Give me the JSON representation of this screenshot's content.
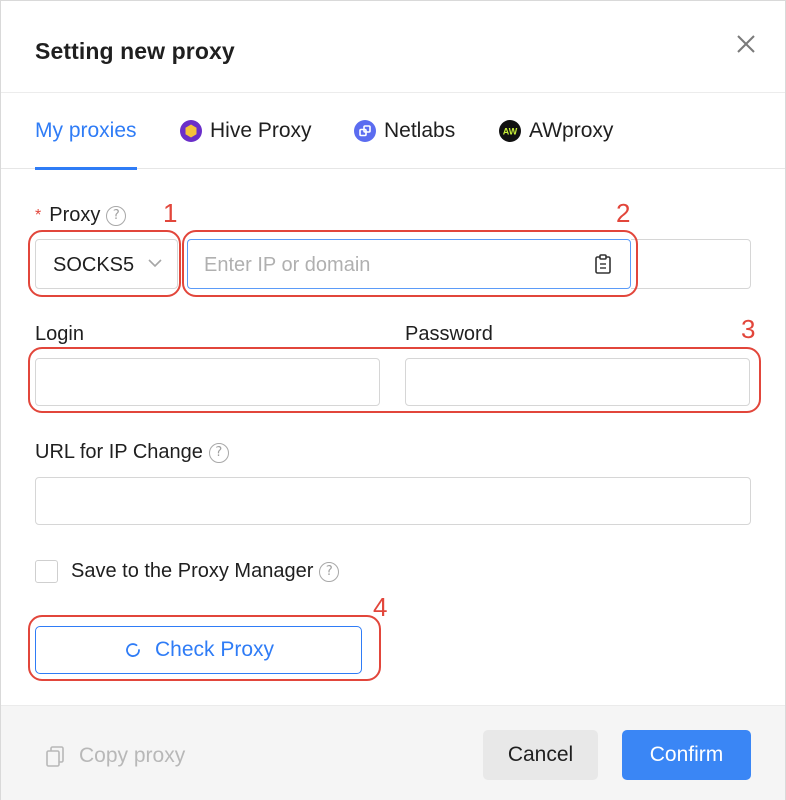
{
  "dialog": {
    "title": "Setting new proxy"
  },
  "tabs": [
    {
      "label": "My proxies",
      "active": true
    },
    {
      "label": "Hive Proxy",
      "icon": "hive-icon"
    },
    {
      "label": "Netlabs",
      "icon": "netlabs-icon"
    },
    {
      "label": "AWproxy",
      "icon": "awproxy-icon"
    }
  ],
  "proxy": {
    "label": "Proxy",
    "required_mark": "*",
    "type_value": "SOCKS5",
    "host_placeholder": "Enter IP or domain"
  },
  "login": {
    "label": "Login",
    "value": ""
  },
  "password": {
    "label": "Password",
    "value": ""
  },
  "ip_change": {
    "label": "URL for IP Change",
    "value": ""
  },
  "save_manager": {
    "label": "Save to the Proxy Manager",
    "checked": false
  },
  "check_proxy": {
    "label": "Check Proxy"
  },
  "footer": {
    "copy_label": "Copy proxy",
    "cancel_label": "Cancel",
    "confirm_label": "Confirm"
  },
  "annotations": [
    "1",
    "2",
    "3",
    "4"
  ],
  "colors": {
    "accent": "#2f7cf6",
    "annotation": "#e2463b",
    "hive": "#6a2ec9",
    "netlabs": "#5b6cf0",
    "awproxy": "#111111"
  }
}
